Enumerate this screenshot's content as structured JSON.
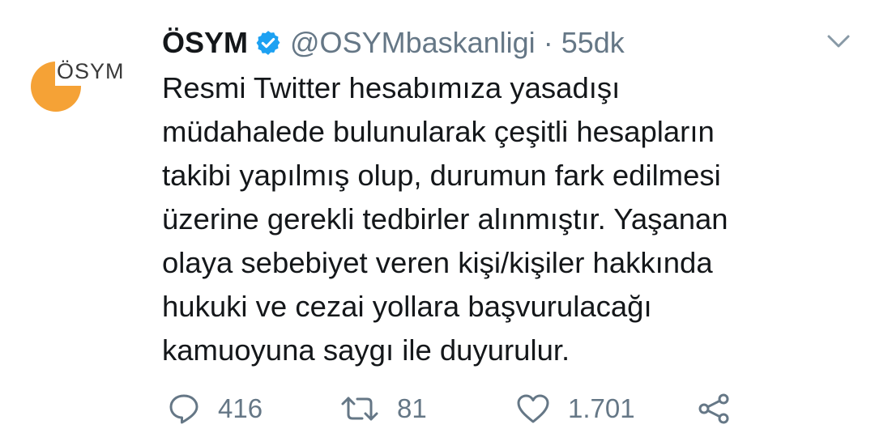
{
  "tweet": {
    "avatar_logo_text": "ÖSYM",
    "author_name": "ÖSYM",
    "handle": "@OSYMbaskanligi",
    "separator": "·",
    "time": "55dk",
    "text_lines": [
      "Resmi Twitter hesabımıza yasadışı",
      "müdahalede bulunularak çeşitli hesapların",
      "takibi yapılmış olup, durumun fark edilmesi",
      "üzerine gerekli tedbirler alınmıştır. Yaşanan",
      "olaya sebebiyet veren kişi/kişiler hakkında",
      "hukuki ve cezai yollara başvurulacağı",
      "kamuoyuna saygı ile duyurulur."
    ],
    "actions": {
      "reply_count": "416",
      "retweet_count": "81",
      "like_count": "1.701"
    }
  },
  "icons": {
    "verified": "verified-badge-icon",
    "caret": "chevron-down-icon",
    "reply": "reply-icon",
    "retweet": "retweet-icon",
    "like": "heart-icon",
    "share": "share-icon"
  },
  "colors": {
    "verified_blue": "#1da1f2",
    "avatar_orange": "#f5a236",
    "secondary_text": "#657786"
  }
}
